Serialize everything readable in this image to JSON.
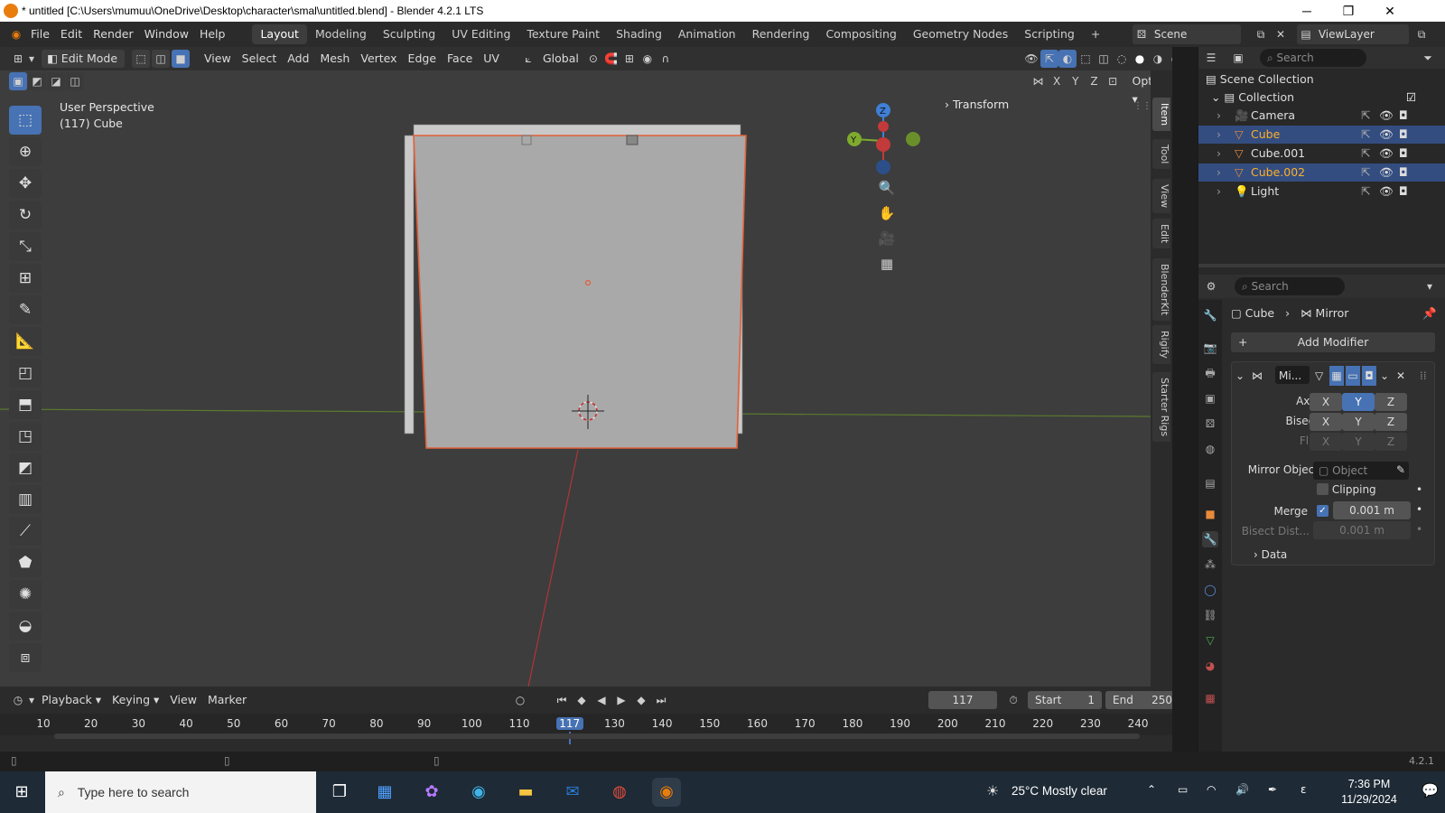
{
  "window": {
    "title": "* untitled [C:\\Users\\mumuu\\OneDrive\\Desktop\\character\\smal\\untitled.blend] - Blender 4.2.1 LTS",
    "minimize": "─",
    "maximize": "❐",
    "close": "✕"
  },
  "menu": [
    "File",
    "Edit",
    "Render",
    "Window",
    "Help"
  ],
  "workspaces": [
    "Layout",
    "Modeling",
    "Sculpting",
    "UV Editing",
    "Texture Paint",
    "Shading",
    "Animation",
    "Rendering",
    "Compositing",
    "Geometry Nodes",
    "Scripting",
    "+"
  ],
  "scene": {
    "label": "Scene",
    "viewlayer": "ViewLayer"
  },
  "header": {
    "mode": "Edit Mode",
    "menus": [
      "View",
      "Select",
      "Add",
      "Mesh",
      "Vertex",
      "Edge",
      "Face",
      "UV"
    ],
    "orientation": "Global",
    "options": "Options",
    "axes": [
      "X",
      "Y",
      "Z"
    ]
  },
  "viewport": {
    "perspective": "User Perspective",
    "object": "(117) Cube",
    "transform_panel": "Transform",
    "gizmo": {
      "x": "X",
      "y": "Y",
      "z": "Z"
    }
  },
  "npanel_tabs": [
    "Item",
    "Tool",
    "View",
    "Edit",
    "BlenderKit",
    "Rigify",
    "Starter Rigs"
  ],
  "outliner": {
    "search_placeholder": "Search",
    "root": "Scene Collection",
    "collection": "Collection",
    "items": [
      {
        "name": "Camera",
        "color": "#e0e0e0",
        "selected": false
      },
      {
        "name": "Cube",
        "color": "#ffaf29",
        "selected": true
      },
      {
        "name": "Cube.001",
        "color": "#e0e0e0",
        "selected": false
      },
      {
        "name": "Cube.002",
        "color": "#ffaf29",
        "selected": true
      },
      {
        "name": "Light",
        "color": "#e0e0e0",
        "selected": false
      }
    ]
  },
  "properties": {
    "search_placeholder": "Search",
    "breadcrumb": {
      "object": "Cube",
      "modifier": "Mirror"
    },
    "add_modifier": "Add Modifier",
    "modifier_name": "Mi...",
    "axis_label": "Axis",
    "bisect_label": "Bisect",
    "flip_label": "Flip",
    "xyz": [
      "X",
      "Y",
      "Z"
    ],
    "mirror_object_label": "Mirror Object",
    "mirror_object_placeholder": "Object",
    "clipping_label": "Clipping",
    "merge_label": "Merge",
    "merge_value": "0.001 m",
    "bisect_dist_label": "Bisect Dist...",
    "bisect_dist_value": "0.001 m",
    "data_label": "Data",
    "accent": "#4772b3"
  },
  "timeline": {
    "menus": [
      "Playback",
      "Keying",
      "View",
      "Marker"
    ],
    "current_frame": "117",
    "start_label": "Start",
    "start_value": "1",
    "end_label": "End",
    "end_value": "250",
    "ticks": [
      "10",
      "20",
      "30",
      "40",
      "50",
      "60",
      "70",
      "80",
      "90",
      "100",
      "110",
      "117",
      "130",
      "140",
      "150",
      "160",
      "170",
      "180",
      "190",
      "200",
      "210",
      "220",
      "230",
      "240"
    ]
  },
  "status": {
    "version": "4.2.1"
  },
  "taskbar": {
    "search_placeholder": "Type here to search",
    "weather": "25°C  Mostly clear",
    "time": "7:36 PM",
    "date": "11/29/2024"
  }
}
